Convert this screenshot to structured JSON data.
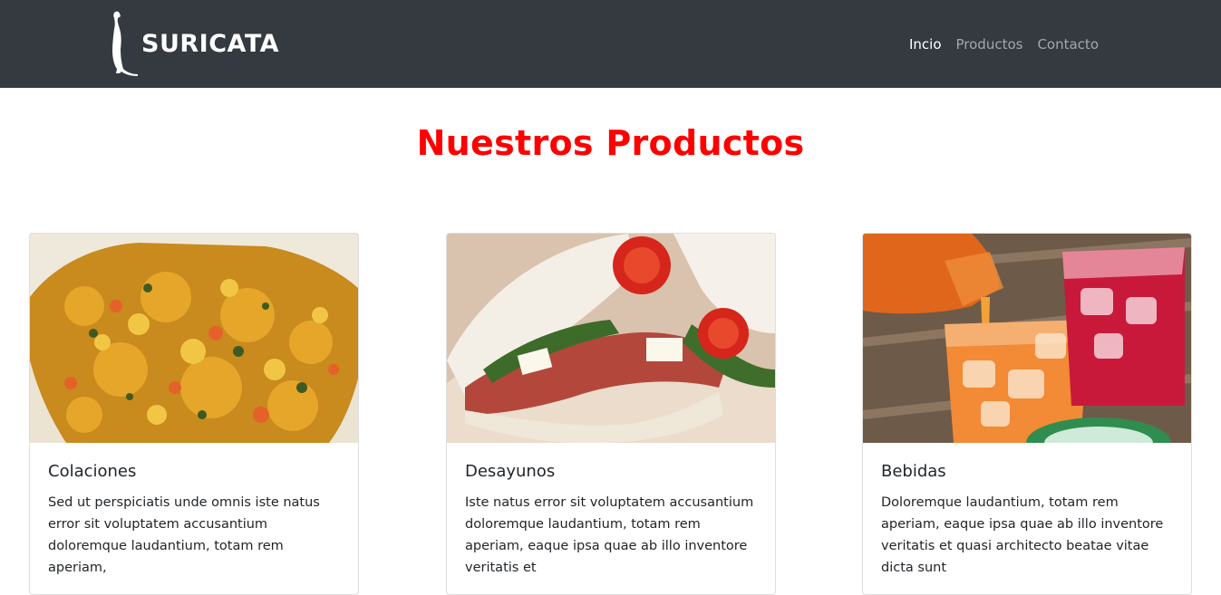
{
  "navbar": {
    "brand": "SURICATA",
    "links": [
      {
        "label": "Incio",
        "active": true
      },
      {
        "label": "Productos",
        "active": false
      },
      {
        "label": "Contacto",
        "active": false
      }
    ]
  },
  "main": {
    "title": "Nuestros Productos",
    "cards": [
      {
        "title": "Colaciones",
        "text": "Sed ut perspiciatis unde omnis iste natus error sit voluptatem accusantium doloremque laudantium, totam rem aperiam,",
        "image": "food-image"
      },
      {
        "title": "Desayunos",
        "text": "Iste natus error sit voluptatem accusantium doloremque laudantium, totam rem aperiam, eaque ipsa quae ab illo inventore veritatis et",
        "image": "sandwich-image"
      },
      {
        "title": "Bebidas",
        "text": "Doloremque laudantium, totam rem aperiam, eaque ipsa quae ab illo inventore veritatis et quasi architecto beatae vitae dicta sunt",
        "image": "drinks-image"
      }
    ]
  },
  "colors": {
    "navbar_bg": "#343a40",
    "title_red": "#ff0000"
  }
}
